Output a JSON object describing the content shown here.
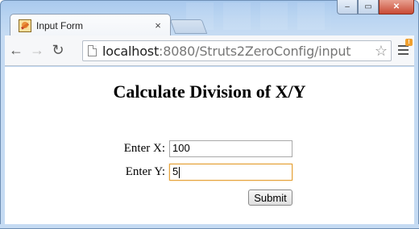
{
  "browser": {
    "tab_title": "Input Form",
    "tab_close": "×",
    "url_host": "localhost",
    "url_rest": ":8080/Struts2ZeroConfig/input",
    "star_icon": "☆",
    "back_icon": "←",
    "forward_icon": "→",
    "reload_icon": "↻",
    "window_controls": {
      "minimize": "‒",
      "maximize": "▭",
      "close": "✕"
    },
    "menu_badge": "!"
  },
  "page": {
    "title": "Calculate Division of X/Y",
    "form": {
      "x_label": "Enter X:",
      "x_value": "100",
      "y_label": "Enter Y:",
      "y_value": "5",
      "submit_label": "Submit"
    }
  },
  "colors": {
    "focus_border": "#e5a23a",
    "frame": "#b9d4f1"
  }
}
